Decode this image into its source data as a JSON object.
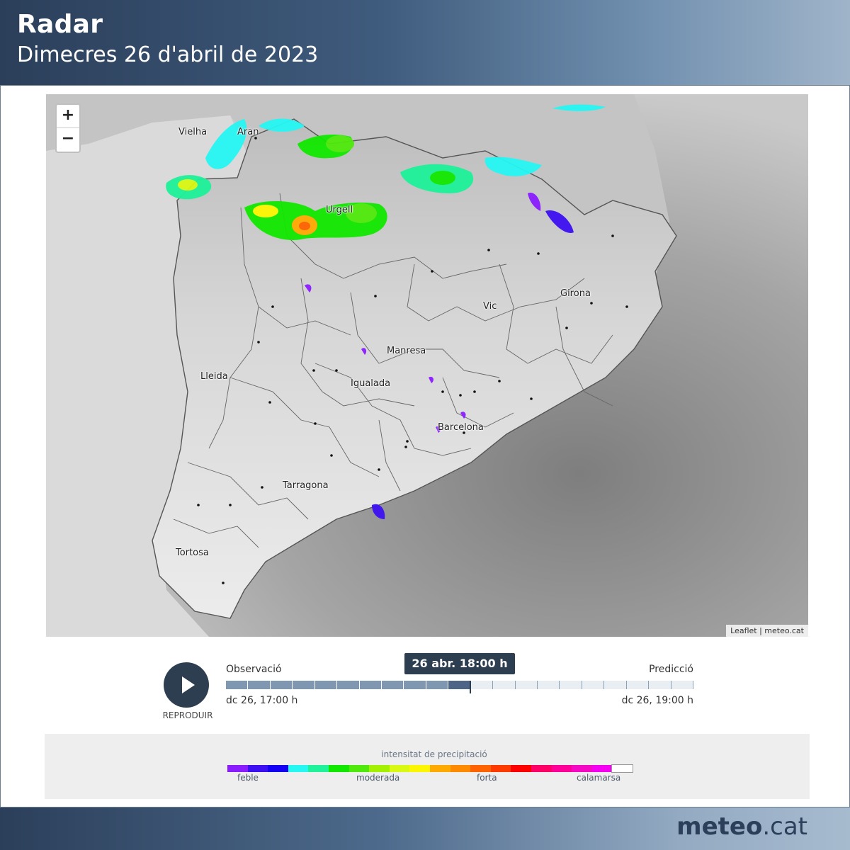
{
  "header": {
    "title": "Radar",
    "subtitle": "Dimecres 26 d'abril de 2023"
  },
  "map": {
    "zoom_in": "+",
    "zoom_out": "−",
    "attribution": "Leaflet | meteo.cat",
    "cities": [
      "Vielha",
      "Aran",
      "Urgell",
      "Girona",
      "Vic",
      "Manresa",
      "Lleida",
      "Igualada",
      "Barcelona",
      "Tarragona",
      "Tortosa"
    ]
  },
  "timeline": {
    "play_label": "REPRODUIR",
    "observation_label": "Observació",
    "prediction_label": "Predicció",
    "start_label": "dc 26, 17:00 h",
    "end_label": "dc 26, 19:00 h",
    "current_time": "26 abr. 18:00 h",
    "past_steps": 11,
    "future_steps": 10
  },
  "legend": {
    "title": "intensitat de precipitació",
    "labels": [
      "feble",
      "moderada",
      "forta",
      "calamarsa"
    ],
    "colors": [
      "#8a1cff",
      "#3c10f2",
      "#1300f5",
      "#25f7f3",
      "#1ef29a",
      "#11e800",
      "#4fea0b",
      "#a3f000",
      "#d9f812",
      "#fcf700",
      "#ffaa00",
      "#ff8a00",
      "#ff6200",
      "#ff3a00",
      "#ff0000",
      "#ff0066",
      "#ff0099",
      "#f509c4",
      "#f500f0",
      "#ffffff"
    ]
  },
  "footer": {
    "brand_bold": "meteo",
    "brand_rest": ".cat"
  }
}
